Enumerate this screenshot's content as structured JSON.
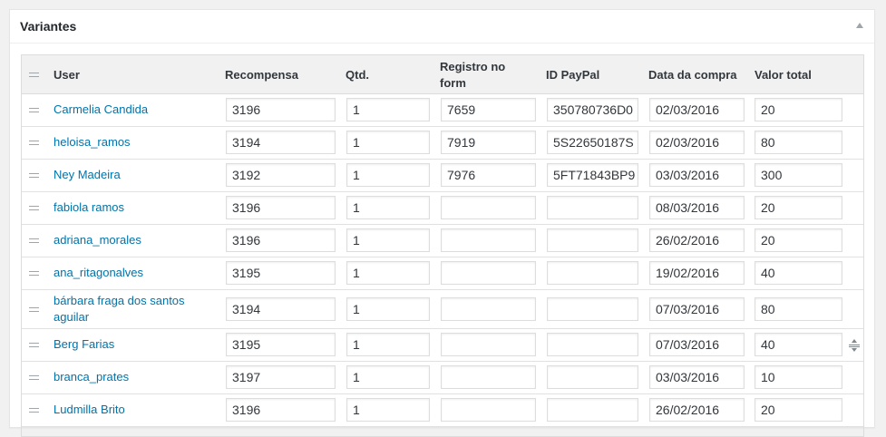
{
  "panel": {
    "title": "Variantes"
  },
  "table": {
    "headers": {
      "user": "User",
      "recompensa": "Recompensa",
      "qtd": "Qtd.",
      "registro": "Registro no form",
      "paypal": "ID PayPal",
      "data": "Data da compra",
      "valor": "Valor total"
    },
    "rows": [
      {
        "user": "Carmelia Candida",
        "recompensa": "3196",
        "qtd": "1",
        "registro": "7659",
        "paypal": "350780736D0",
        "data": "02/03/2016",
        "valor": "20"
      },
      {
        "user": "heloisa_ramos",
        "recompensa": "3194",
        "qtd": "1",
        "registro": "7919",
        "paypal": "5S22650187S",
        "data": "02/03/2016",
        "valor": "80"
      },
      {
        "user": "Ney Madeira",
        "recompensa": "3192",
        "qtd": "1",
        "registro": "7976",
        "paypal": "5FT71843BP9",
        "data": "03/03/2016",
        "valor": "300"
      },
      {
        "user": "fabiola ramos",
        "recompensa": "3196",
        "qtd": "1",
        "registro": "",
        "paypal": "",
        "data": "08/03/2016",
        "valor": "20"
      },
      {
        "user": "adriana_morales",
        "recompensa": "3196",
        "qtd": "1",
        "registro": "",
        "paypal": "",
        "data": "26/02/2016",
        "valor": "20"
      },
      {
        "user": "ana_ritagonalves",
        "recompensa": "3195",
        "qtd": "1",
        "registro": "",
        "paypal": "",
        "data": "19/02/2016",
        "valor": "40"
      },
      {
        "user": "bárbara fraga dos santos aguilar",
        "recompensa": "3194",
        "qtd": "1",
        "registro": "",
        "paypal": "",
        "data": "07/03/2016",
        "valor": "80"
      },
      {
        "user": "Berg Farias",
        "recompensa": "3195",
        "qtd": "1",
        "registro": "",
        "paypal": "",
        "data": "07/03/2016",
        "valor": "40"
      },
      {
        "user": "branca_prates",
        "recompensa": "3197",
        "qtd": "1",
        "registro": "",
        "paypal": "",
        "data": "03/03/2016",
        "valor": "10"
      },
      {
        "user": "Ludmilla Brito",
        "recompensa": "3196",
        "qtd": "1",
        "registro": "",
        "paypal": "",
        "data": "26/02/2016",
        "valor": "20"
      }
    ]
  },
  "icons": {
    "collapse": "triangle-up-icon",
    "drag": "drag-handle-icon",
    "resize": "vertical-resize-icon"
  },
  "colors": {
    "link": "#0073aa",
    "header_bg": "#f1f1f1",
    "border": "#dcdcdc"
  }
}
